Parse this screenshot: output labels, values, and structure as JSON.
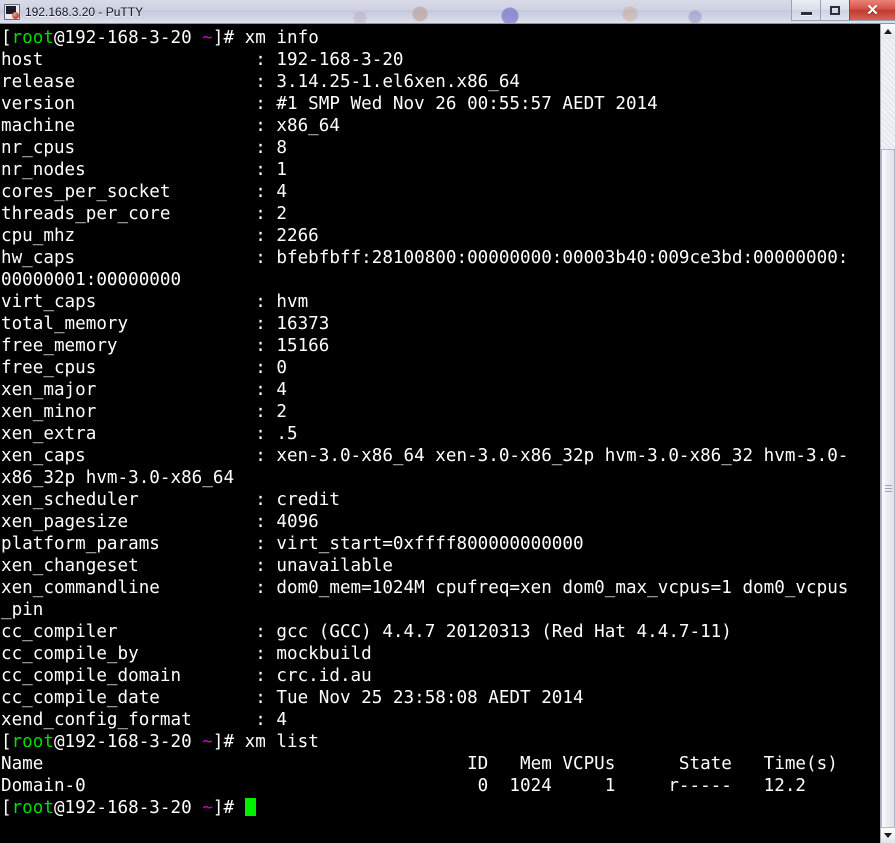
{
  "window": {
    "title": "192.168.3.20 - PuTTY",
    "icon": "putty-terminal-icon",
    "buttons": {
      "minimize": "minimize-button",
      "maximize": "maximize-button",
      "close_glyph": "✕"
    }
  },
  "terminal": {
    "prompt": {
      "open_bracket": "[",
      "user": "root",
      "at_host": "@192-168-3-20",
      "space": " ",
      "path": "~",
      "close": "]# "
    },
    "commands": {
      "xm_info": "xm info",
      "xm_list": "xm list"
    },
    "xm_info": [
      {
        "key": "host",
        "value": "192-168-3-20"
      },
      {
        "key": "release",
        "value": "3.14.25-1.el6xen.x86_64"
      },
      {
        "key": "version",
        "value": "#1 SMP Wed Nov 26 00:55:57 AEDT 2014"
      },
      {
        "key": "machine",
        "value": "x86_64"
      },
      {
        "key": "nr_cpus",
        "value": "8"
      },
      {
        "key": "nr_nodes",
        "value": "1"
      },
      {
        "key": "cores_per_socket",
        "value": "4"
      },
      {
        "key": "threads_per_core",
        "value": "2"
      },
      {
        "key": "cpu_mhz",
        "value": "2266"
      },
      {
        "key": "hw_caps",
        "value": "bfebfbff:28100800:00000000:00003b40:009ce3bd:00000000:00000001:00000000"
      },
      {
        "key": "virt_caps",
        "value": "hvm"
      },
      {
        "key": "total_memory",
        "value": "16373"
      },
      {
        "key": "free_memory",
        "value": "15166"
      },
      {
        "key": "free_cpus",
        "value": "0"
      },
      {
        "key": "xen_major",
        "value": "4"
      },
      {
        "key": "xen_minor",
        "value": "2"
      },
      {
        "key": "xen_extra",
        "value": ".5"
      },
      {
        "key": "xen_caps",
        "value": "xen-3.0-x86_64 xen-3.0-x86_32p hvm-3.0-x86_32 hvm-3.0-x86_32p hvm-3.0-x86_64"
      },
      {
        "key": "xen_scheduler",
        "value": "credit"
      },
      {
        "key": "xen_pagesize",
        "value": "4096"
      },
      {
        "key": "platform_params",
        "value": "virt_start=0xffff800000000000"
      },
      {
        "key": "xen_changeset",
        "value": "unavailable"
      },
      {
        "key": "xen_commandline",
        "value": "dom0_mem=1024M cpufreq=xen dom0_max_vcpus=1 dom0_vcpus_pin"
      },
      {
        "key": "cc_compiler",
        "value": "gcc (GCC) 4.4.7 20120313 (Red Hat 4.4.7-11)"
      },
      {
        "key": "cc_compile_by",
        "value": "mockbuild"
      },
      {
        "key": "cc_compile_domain",
        "value": "crc.id.au"
      },
      {
        "key": "cc_compile_date",
        "value": "Tue Nov 25 23:58:08 AEDT 2014"
      },
      {
        "key": "xend_config_format",
        "value": "4"
      }
    ],
    "xm_list": {
      "header": [
        "Name",
        "ID",
        "Mem",
        "VCPUs",
        "State",
        "Time(s)"
      ],
      "header_line": "Name                                        ID   Mem VCPUs      State   Time(s)",
      "rows": [
        {
          "name": "Domain-0",
          "id": "0",
          "mem": "1024",
          "vcpus": "1",
          "state": "r-----",
          "time": "12.2",
          "line": "Domain-0                                     0  1024     1     r-----   12.2"
        }
      ]
    },
    "cursor": "block-cursor",
    "colors": {
      "background": "#000000",
      "foreground": "#ffffff",
      "user_green": "#00dd00",
      "path_magenta": "#cd00cd",
      "cursor_green": "#00ee00"
    }
  },
  "scrollbar": {
    "up_arrow": "scroll-up-arrow",
    "down_arrow": "scroll-down-arrow",
    "thumb": "scroll-thumb"
  }
}
